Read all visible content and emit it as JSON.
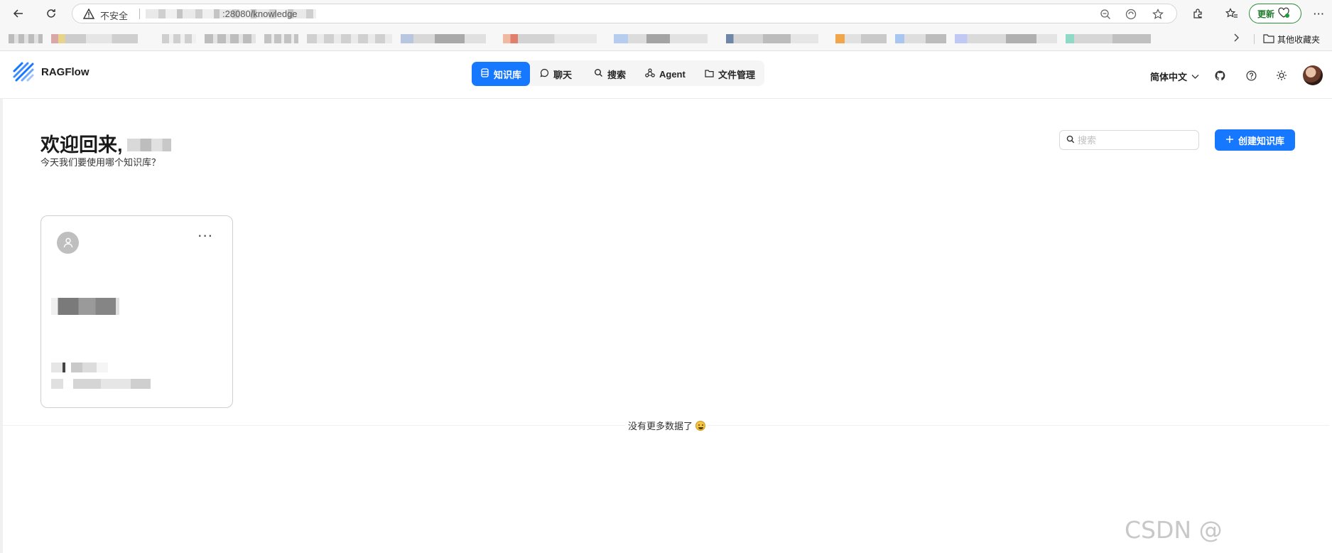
{
  "browser": {
    "insecure_label": "不安全",
    "url_suffix": ":28080/knowledge",
    "update_label": "更新",
    "more_label": "···",
    "other_favorites": "其他收藏夹"
  },
  "app": {
    "name": "RAGFlow",
    "nav": [
      {
        "label": "知识库",
        "icon": "database-icon",
        "active": true
      },
      {
        "label": "聊天",
        "icon": "chat-bubble-icon",
        "active": false
      },
      {
        "label": "搜索",
        "icon": "search-icon",
        "active": false
      },
      {
        "label": "Agent",
        "icon": "agent-graph-icon",
        "active": false
      },
      {
        "label": "文件管理",
        "icon": "folder-icon",
        "active": false
      }
    ],
    "language": "简体中文",
    "accent_color": "#1677ff"
  },
  "main": {
    "welcome": "欢迎回来,",
    "subtitle": "今天我们要使用哪个知识库？",
    "search_placeholder": "搜索",
    "create_button": "创建知识库",
    "no_more": "没有更多数据了"
  },
  "watermark": "CSDN @"
}
